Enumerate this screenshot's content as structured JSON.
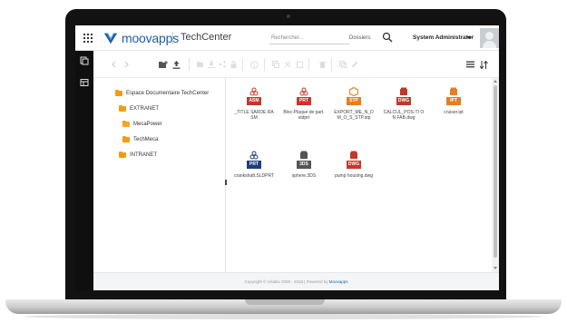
{
  "header": {
    "logo_text": "moovapps",
    "site_title": "TechCenter",
    "search_placeholder": "Rechercher...",
    "search_scope": "Dossiers",
    "user_name": "System Administrator"
  },
  "tree": {
    "items": [
      {
        "label": "Espace Documentaire TechCenter",
        "level": 0
      },
      {
        "label": "EXTRANET",
        "level": 1
      },
      {
        "label": "MecaPower",
        "level": 2
      },
      {
        "label": "TechMeca",
        "level": 2
      },
      {
        "label": "INTRANET",
        "level": 1
      }
    ]
  },
  "files": [
    {
      "badge": "ASM",
      "name": "_TITLE SARDE RASM",
      "color": "#c0392b",
      "icon": "cad-assembly-icon"
    },
    {
      "badge": "PRT",
      "name": "Bloc-Plaque de part.stdprt",
      "color": "#c0392b",
      "icon": "cad-part-icon"
    },
    {
      "badge": "STP",
      "name": "EXPORT_ME_N_D M_O_S_STP.stp",
      "color": "#e67e22",
      "icon": "step-file-icon"
    },
    {
      "badge": "DWG",
      "name": "CALCUL_POS-TI ON FAB.dwg",
      "color": "#c0392b",
      "icon": "drawing-file-icon"
    },
    {
      "badge": "IPT",
      "name": "cruiser.ipt",
      "color": "#e67e22",
      "icon": "inventor-part-icon"
    },
    {
      "badge": "PRT",
      "name": "crankshaft.SLDPRT",
      "color": "#1f3f7a",
      "icon": "cad-part-icon"
    },
    {
      "badge": "3DS",
      "name": "sphere.3DS",
      "color": "#555555",
      "icon": "3d-model-icon"
    },
    {
      "badge": "DWG",
      "name": "pump housing.dwg",
      "color": "#c0392b",
      "icon": "drawing-file-icon"
    }
  ],
  "footer": {
    "text": "Copyright © Visiativ 2000 - 2019 | Powered by ",
    "brand": "Moovapps"
  },
  "colors": {
    "brand_blue": "#1f5fa8",
    "folder": "#f39c12",
    "rail": "#0f0f0f"
  }
}
